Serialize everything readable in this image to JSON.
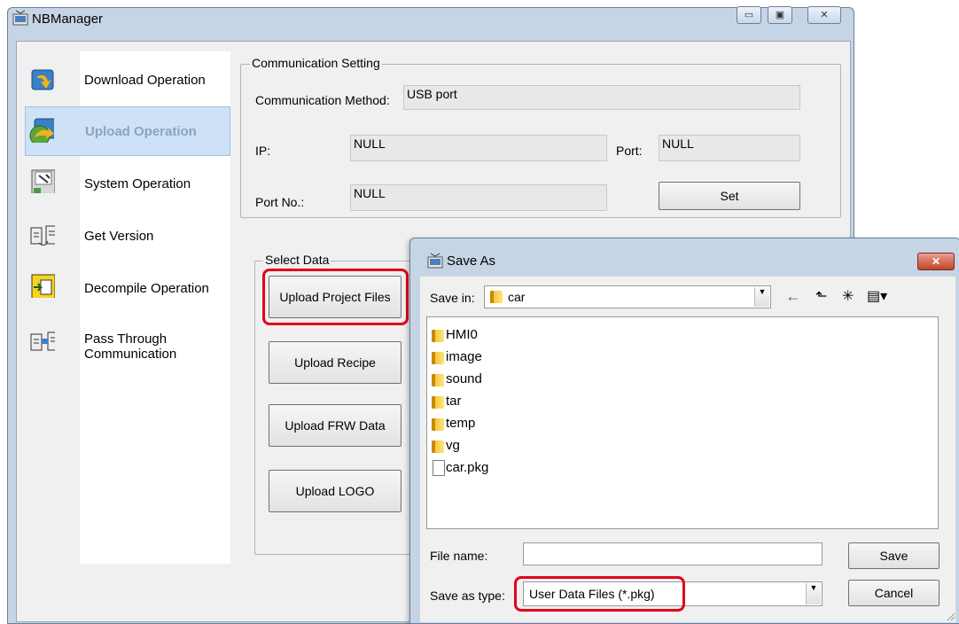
{
  "main_window": {
    "title": "NBManager",
    "minimize": "▭",
    "maximize": "▣",
    "close": "✕"
  },
  "sidebar": {
    "items": [
      {
        "label": "Download Operation",
        "icon": "download-operation-icon"
      },
      {
        "label": "Upload Operation",
        "icon": "upload-operation-icon"
      },
      {
        "label": "System Operation",
        "icon": "system-operation-icon"
      },
      {
        "label": "Get Version",
        "icon": "get-version-icon"
      },
      {
        "label": "Decompile Operation",
        "icon": "decompile-operation-icon"
      },
      {
        "label": "Pass Through\nCommunication",
        "icon": "pass-through-communication-icon"
      }
    ],
    "selected": "Upload Operation"
  },
  "communication": {
    "legend": "Communication Setting",
    "method_label": "Communication Method:",
    "method_value": "USB port",
    "ip_label": "IP:",
    "ip_value": "NULL",
    "port_label": "Port:",
    "port_value": "NULL",
    "portno_label": "Port No.:",
    "portno_value": "NULL",
    "set_button": "Set"
  },
  "select_data": {
    "legend": "Select Data",
    "buttons": [
      "Upload Project Files",
      "Upload Recipe",
      "Upload FRW Data",
      "Upload LOGO"
    ]
  },
  "save_dialog": {
    "title": "Save As",
    "close": "✕",
    "save_in_label": "Save in:",
    "save_in_value": "car",
    "toolbar": {
      "back": "←",
      "up": "⬑",
      "new_folder": "✳",
      "view": "▤▾"
    },
    "files": [
      {
        "name": "HMI0",
        "type": "folder"
      },
      {
        "name": "image",
        "type": "folder"
      },
      {
        "name": "sound",
        "type": "folder"
      },
      {
        "name": "tar",
        "type": "folder"
      },
      {
        "name": "temp",
        "type": "folder"
      },
      {
        "name": "vg",
        "type": "folder"
      },
      {
        "name": "car.pkg",
        "type": "file"
      }
    ],
    "file_name_label": "File name:",
    "file_name_value": "",
    "save_type_label": "Save as type:",
    "save_type_value": "User Data Files (*.pkg)",
    "save_button": "Save",
    "cancel_button": "Cancel"
  },
  "colors": {
    "highlight": "#e3001b",
    "selection": "#cde2f6",
    "titlebar": "#c6d5e6"
  }
}
